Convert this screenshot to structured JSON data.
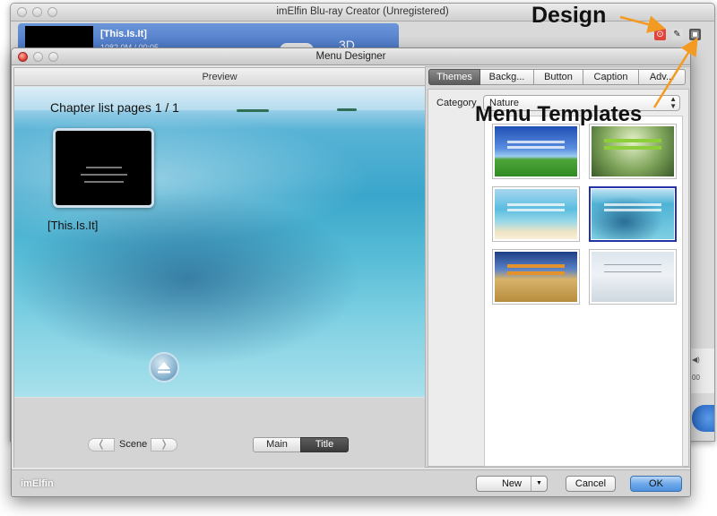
{
  "back_window": {
    "title": "imElfin Blu-ray Creator (Unregistered)",
    "item_name": "[This.Is.It]",
    "item_sub": "1082.0M / 00:05",
    "label_3d": "3D",
    "side_audio": "◀)",
    "side_time": "00"
  },
  "annotations": {
    "design": "Design",
    "menu_templates": "Menu Templates"
  },
  "menu_designer": {
    "title": "Menu Designer",
    "preview": {
      "header": "Preview",
      "chapter_title": "Chapter list pages 1 / 1",
      "chapter_label": "[This.Is.It]",
      "scene_label": "Scene",
      "prev_glyph": "❬",
      "next_glyph": "❭",
      "mode_main": "Main",
      "mode_title": "Title"
    },
    "tabs": [
      "Themes",
      "Backg...",
      "Button",
      "Caption",
      "Adv..."
    ],
    "active_tab": "Themes",
    "category_label": "Category",
    "category_value": "Nature",
    "templates": [
      {
        "name": "grass-sky",
        "selected": false
      },
      {
        "name": "green-forest",
        "selected": false
      },
      {
        "name": "beach-sand",
        "selected": false
      },
      {
        "name": "tropical-water",
        "selected": true
      },
      {
        "name": "wheat-field",
        "selected": false
      },
      {
        "name": "winter-fence",
        "selected": false
      }
    ],
    "footer": {
      "logo": "imElfin",
      "new_label": "New",
      "new_arrow": "▼",
      "cancel_label": "Cancel",
      "ok_label": "OK"
    }
  },
  "colors": {
    "accent_blue": "#4f91de",
    "annotation_arrow": "#f39a22",
    "selected_template_border": "#2433a8"
  }
}
